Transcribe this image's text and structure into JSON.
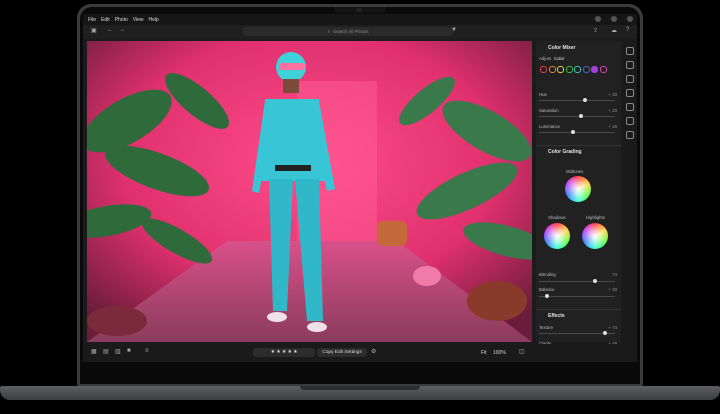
{
  "menu": [
    "File",
    "Edit",
    "Photo",
    "View",
    "Help"
  ],
  "search": {
    "placeholder": "Search All Photos"
  },
  "panel": {
    "color_mixer": {
      "title": "Color Mixer",
      "adjust_label": "Adjust",
      "adjust_value": "Color",
      "swatch_colors": [
        "#e04040",
        "#e08a30",
        "#e0d040",
        "#40c040",
        "#40c0c0",
        "#4060e0",
        "#a040e0",
        "#e040b0"
      ],
      "sliders": [
        {
          "label": "Hue",
          "value": "+ 33",
          "level": 0.6
        },
        {
          "label": "Saturation",
          "value": "+ 23",
          "level": 0.55
        },
        {
          "label": "Luminance",
          "value": "+ 16",
          "level": 0.45
        }
      ]
    },
    "color_grading": {
      "title": "Color Grading",
      "midtones_label": "Midtones",
      "shadows_label": "Shadows",
      "highlights_label": "Highlights",
      "blending_label": "Blending",
      "blending_value": "74",
      "blending_level": 0.74,
      "balance_label": "Balance",
      "balance_value": "+ 33",
      "balance_level": 0.1
    },
    "effects": {
      "title": "Effects",
      "sliders": [
        {
          "label": "Texture",
          "value": "+ 74",
          "level": 0.87
        },
        {
          "label": "Clarity",
          "value": "+ 48",
          "level": 0.74
        },
        {
          "label": "Dehaze",
          "value": "+ 18",
          "level": 0.3
        }
      ]
    }
  },
  "bottombar": {
    "rating": "★ ★ ★ ★ ★",
    "copy_settings": "Copy Edit Settings",
    "fit_label": "Fit",
    "zoom": "100%"
  }
}
